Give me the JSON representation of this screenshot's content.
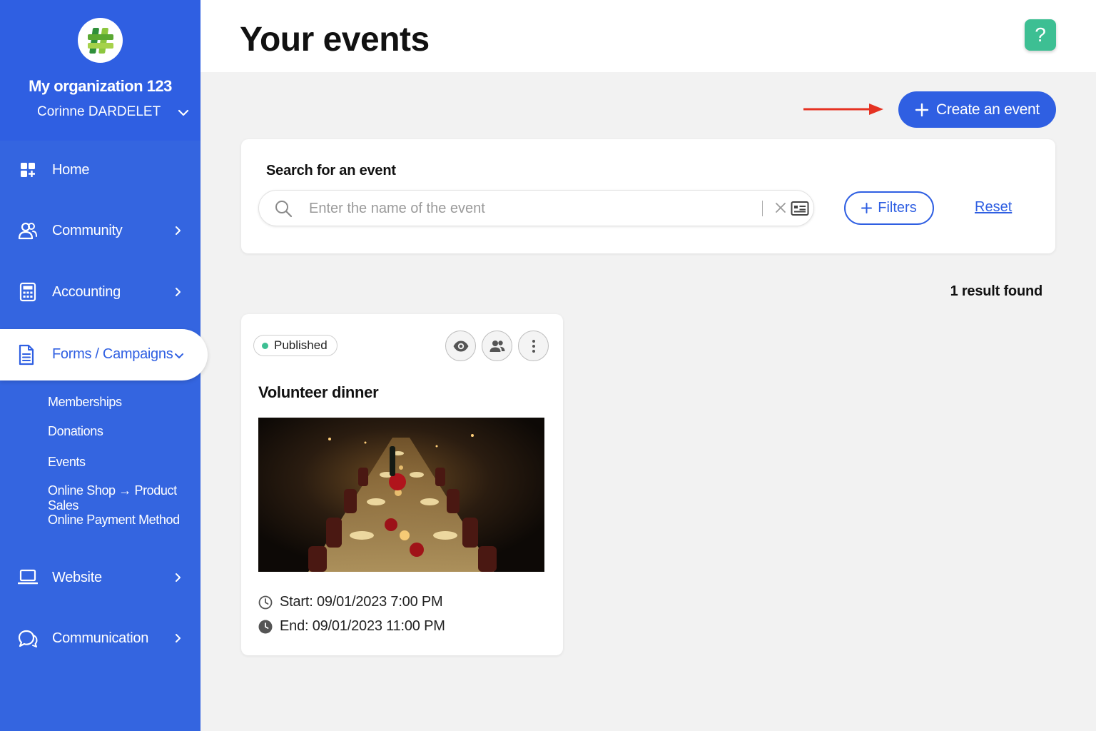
{
  "sidebar": {
    "org_name": "My organization 123",
    "user_name": "Corinne DARDELET",
    "nav": [
      {
        "label": "Home",
        "icon": "dashboard-icon"
      },
      {
        "label": "Community",
        "icon": "users-icon"
      },
      {
        "label": "Accounting",
        "icon": "calculator-icon"
      },
      {
        "label": "Forms / Campaigns",
        "icon": "document-icon"
      },
      {
        "label": "Website",
        "icon": "laptop-icon"
      },
      {
        "label": "Communication",
        "icon": "chat-icon"
      }
    ],
    "subitems": [
      "Memberships",
      "Donations",
      "Events",
      "Online Shop → Product Sales",
      "Online Payment Method"
    ]
  },
  "header": {
    "title": "Your events",
    "help_label": "?"
  },
  "toolbar": {
    "create_label": "Create an event"
  },
  "search": {
    "label": "Search for an event",
    "placeholder": "Enter the name of the event",
    "filters_label": "Filters",
    "reset_label": "Reset"
  },
  "results": {
    "text": "1 result found"
  },
  "event": {
    "status": "Published",
    "title": "Volunteer dinner",
    "start": "Start: 09/01/2023 7:00 PM",
    "end": "End: 09/01/2023 11:00 PM"
  },
  "colors": {
    "brand_blue": "#2f5fe2",
    "sidebar_blue": "#3465e0",
    "help_green": "#3dbf93",
    "arrow_red": "#e53222"
  }
}
